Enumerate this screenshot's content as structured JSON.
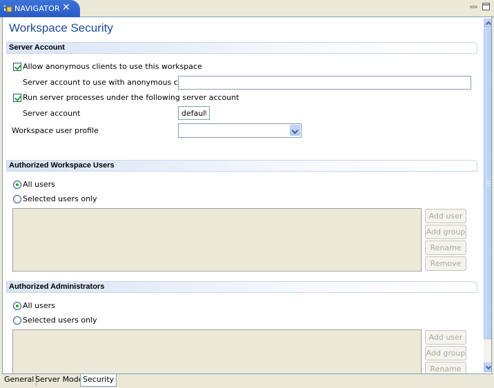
{
  "tab": {
    "title": "NAVIGATOR",
    "close_symbol": "✕"
  },
  "form": {
    "title": "Workspace Security"
  },
  "server_account_section": {
    "title": "Server Account",
    "allow_anonymous": {
      "label": "Allow anonymous clients to use this workspace",
      "checked": true
    },
    "anon_account_label": "Server account to use with anonymous clients",
    "anon_account_value": "",
    "run_processes": {
      "label": "Run server processes under the following server account",
      "checked": true
    },
    "server_account_label": "Server account",
    "server_account_value": "default",
    "user_profile_label": "Workspace user profile",
    "user_profile_value": ""
  },
  "users_section": {
    "title": "Authorized Workspace Users",
    "all_users": "All users",
    "selected_users": "Selected users only",
    "buttons": {
      "add_user": "Add user",
      "add_group": "Add group",
      "rename": "Rename",
      "remove": "Remove"
    }
  },
  "admins_section": {
    "title": "Authorized Administrators",
    "all_users": "All users",
    "selected_users": "Selected users only",
    "buttons": {
      "add_user": "Add user",
      "add_group": "Add group",
      "rename": "Rename"
    }
  },
  "page_tabs": [
    "General",
    "Server Mode",
    "Security"
  ],
  "colors": {
    "title": "#1e4a96",
    "tab_active": "#2a5bc4",
    "check": "#21a121"
  }
}
